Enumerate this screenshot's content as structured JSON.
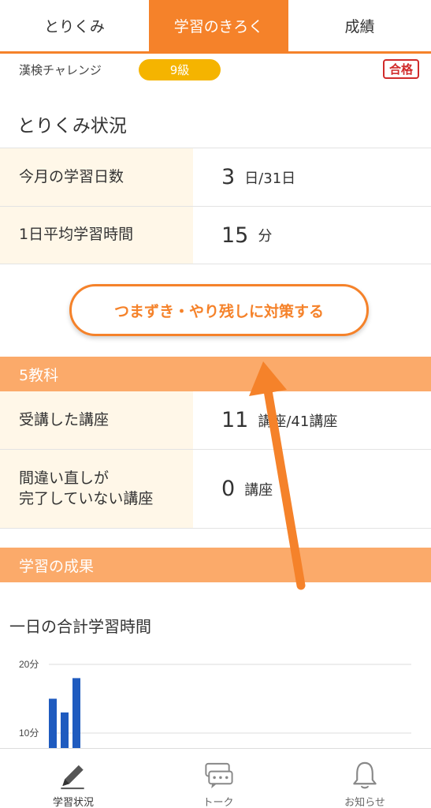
{
  "tabs": [
    "とりくみ",
    "学習のきろく",
    "成績"
  ],
  "kanken": {
    "label": "漢検チャレンジ",
    "grade": "9級",
    "badge": "合格"
  },
  "status": {
    "title": "とりくみ状況",
    "rows": [
      {
        "label": "今月の学習日数",
        "value": "3",
        "unit": "日/31日"
      },
      {
        "label": "1日平均学習時間",
        "value": "15",
        "unit": "分"
      }
    ]
  },
  "cta_label": "つまずき・やり残しに対策する",
  "subjects": {
    "title": "5教科",
    "rows": [
      {
        "label": "受講した講座",
        "value": "11",
        "unit": "講座/41講座"
      },
      {
        "label_line1": "間違い直しが",
        "label_line2": "完了していない講座",
        "value": "0",
        "unit": "講座"
      }
    ]
  },
  "results": {
    "title": "学習の成果"
  },
  "chart_title": "一日の合計学習時間",
  "chart_data": {
    "type": "bar",
    "ytick_labels": [
      "20分",
      "10分"
    ],
    "yticks": [
      20,
      10
    ],
    "values": [
      15,
      13,
      18
    ],
    "color": "#1f5bbf"
  },
  "nav": [
    {
      "label": "学習状況",
      "icon": "pencil-icon"
    },
    {
      "label": "トーク",
      "icon": "chat-icon"
    },
    {
      "label": "お知らせ",
      "icon": "bell-icon"
    }
  ],
  "colors": {
    "accent": "#f5822a",
    "band": "#fbaa6a",
    "grade": "#f5b400",
    "pass": "#d12b2b",
    "label_bg": "#fff7e8"
  }
}
